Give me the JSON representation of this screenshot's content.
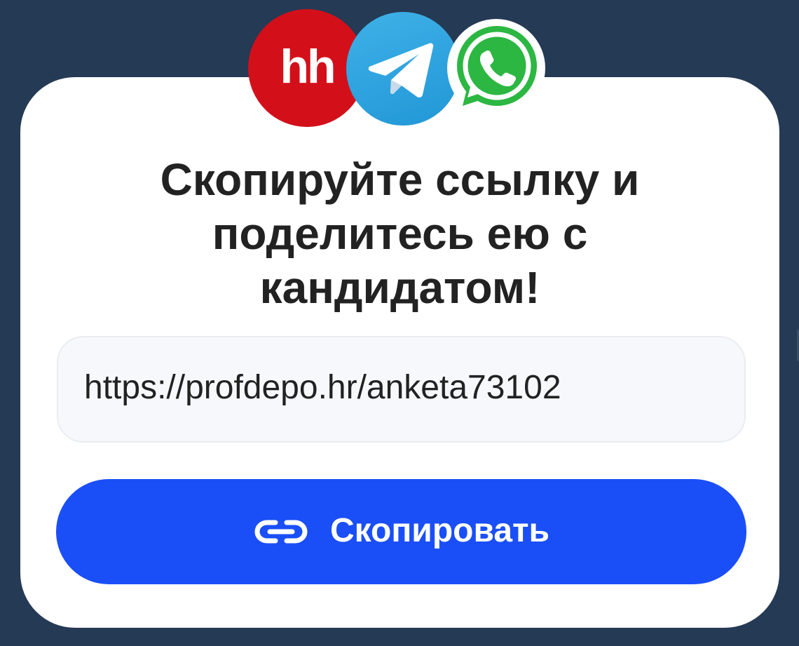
{
  "card": {
    "title_line1": "Скопируйте ссылку и",
    "title_line2": "поделитесь ею с",
    "title_line3": "кандидатом!",
    "link_value": "https://profdepo.hr/anketa73102",
    "copy_button_label": "Скопировать"
  },
  "icons": {
    "hh_logo_text": "hh",
    "hh_logo": "hh-logo-icon",
    "telegram_logo": "telegram-icon",
    "whatsapp_logo": "whatsapp-icon",
    "link": "link-icon"
  },
  "colors": {
    "background": "#253a54",
    "card": "#ffffff",
    "accent": "#1a4ff7",
    "hh_red": "#d3101a",
    "telegram_blue": "#2aa1dd",
    "whatsapp_green": "#2cb742",
    "title_text": "#222222",
    "field_bg": "#f6f8fb"
  }
}
